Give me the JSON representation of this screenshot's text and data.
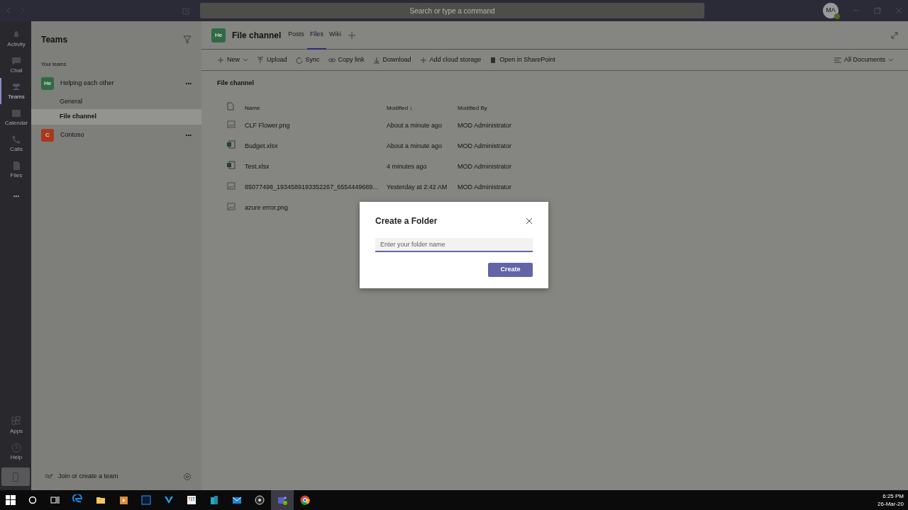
{
  "title_bar": {
    "search": {
      "placeholder": "Search or type a command"
    },
    "avatar": "MA"
  },
  "rail": {
    "items": [
      {
        "kind": "bell",
        "label": "Activity",
        "selected": false
      },
      {
        "kind": "chat",
        "label": "Chat",
        "selected": false
      },
      {
        "kind": "teams",
        "label": "Teams",
        "selected": true
      },
      {
        "kind": "calendar",
        "label": "Calendar",
        "selected": false
      },
      {
        "kind": "phone",
        "label": "Calls",
        "selected": false
      },
      {
        "kind": "file",
        "label": "Files",
        "selected": false
      }
    ],
    "more": "•••",
    "bottom_items": [
      {
        "kind": "apps",
        "label": "Apps"
      },
      {
        "kind": "help",
        "label": "Help"
      }
    ]
  },
  "teams_panel": {
    "title": "Teams",
    "section": "Your teams",
    "teams": [
      {
        "name": "Helping each other",
        "initials": "He",
        "color": "#2f6a45",
        "more": "•••",
        "channels": [
          {
            "name": "General",
            "selected": false
          },
          {
            "name": "File channel",
            "selected": true
          }
        ]
      },
      {
        "name": "Contoso",
        "initials": "C",
        "color": "#a8391b",
        "more": "•••"
      }
    ],
    "footer": "Join or create a team"
  },
  "channel": {
    "initials": "He",
    "title": "File channel",
    "tabs": [
      {
        "label": "Posts",
        "selected": false
      },
      {
        "label": "Files",
        "selected": true
      },
      {
        "label": "Wiki",
        "selected": false
      }
    ],
    "toolbar": [
      {
        "kind": "plus",
        "label": "New",
        "dropdown": true
      },
      {
        "kind": "upload",
        "label": "Upload",
        "dropdown": false
      },
      {
        "kind": "sync",
        "label": "Sync",
        "dropdown": false
      },
      {
        "kind": "link",
        "label": "Copy link",
        "dropdown": false
      },
      {
        "kind": "download",
        "label": "Download",
        "dropdown": false
      },
      {
        "kind": "plus",
        "label": "Add cloud storage",
        "dropdown": false
      },
      {
        "kind": "sharepoint",
        "label": "Open in SharePoint",
        "dropdown": false
      }
    ],
    "view": "All Documents",
    "breadcrumb": "File channel",
    "table": {
      "columns": [
        "Name",
        "Modified ↓",
        "Modified By"
      ],
      "rows": [
        {
          "kind": "image",
          "name": "CLF Flower.png",
          "modified": "About a minute ago",
          "by": "MOD Administrator"
        },
        {
          "kind": "excel",
          "name": "Budget.xlsx",
          "modified": "About a minute ago",
          "by": "MOD Administrator"
        },
        {
          "kind": "excel",
          "name": "Test.xlsx",
          "modified": "4 minutes ago",
          "by": "MOD Administrator"
        },
        {
          "kind": "image",
          "name": "85077498_1934589193352267_6554449689...",
          "modified": "Yesterday at 2:42 AM",
          "by": "MOD Administrator"
        },
        {
          "kind": "image",
          "name": "azure error.png"
        }
      ]
    }
  },
  "dialog": {
    "title": "Create a Folder",
    "placeholder": "Enter your folder name",
    "button": "Create"
  },
  "taskbar": {
    "apps": [
      {
        "kind": "edge",
        "selected": false
      },
      {
        "kind": "folder",
        "selected": false
      },
      {
        "kind": "player",
        "selected": false
      },
      {
        "kind": "ps",
        "selected": false
      },
      {
        "kind": "v",
        "selected": false
      },
      {
        "kind": "grid",
        "selected": false
      },
      {
        "kind": "store",
        "selected": false
      },
      {
        "kind": "mail",
        "selected": false
      },
      {
        "kind": "obs",
        "selected": false
      },
      {
        "kind": "teams",
        "selected": true
      },
      {
        "kind": "chrome",
        "selected": false
      }
    ],
    "time": "6:25 PM",
    "date": "26-Mar-20"
  }
}
